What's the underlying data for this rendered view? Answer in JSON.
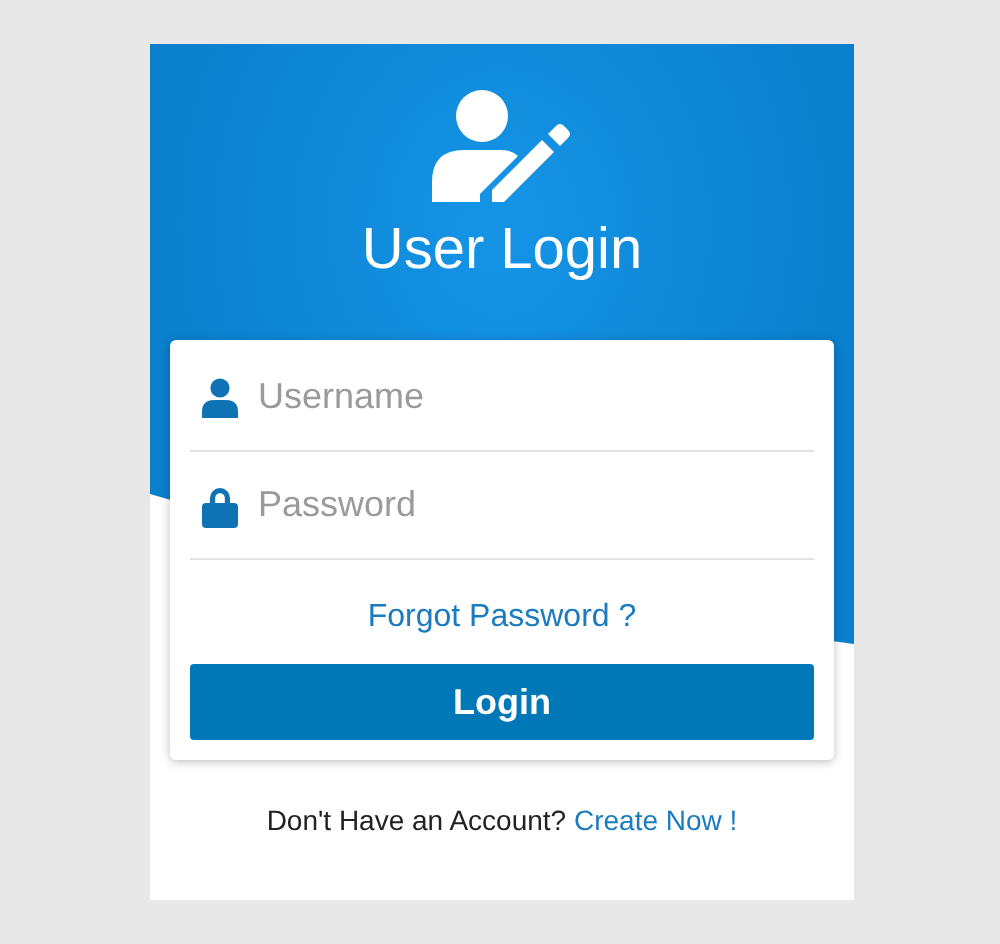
{
  "header": {
    "title": "User Login"
  },
  "fields": [
    {
      "kind": "user",
      "placeholder": "Username"
    },
    {
      "kind": "password",
      "placeholder": "Password"
    }
  ],
  "forgot_link": "Forgot Password ?",
  "login_button": "Login",
  "footer": {
    "text": "Don't Have an Account?",
    "link": "Create Now !"
  }
}
